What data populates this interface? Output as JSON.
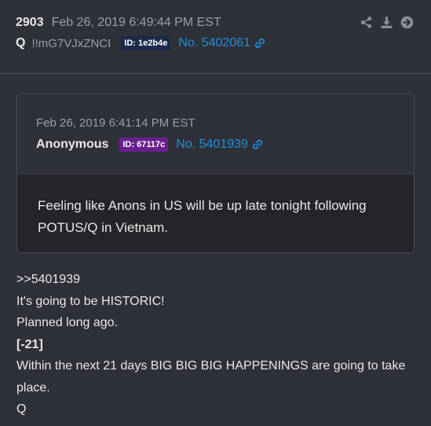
{
  "post": {
    "number": "2903",
    "timestamp": "Feb 26, 2019 6:49:44 PM EST",
    "author": "Q",
    "tripcode": "!!mG7VJxZNCI",
    "id_label": "ID: 1e2b4e",
    "id_color": "#1b2a4a",
    "post_link": "No. 5402061",
    "link_color": "#1e90dd",
    "action_icons": [
      "share-icon",
      "download-icon",
      "arrow-right-circle-icon"
    ]
  },
  "quote": {
    "timestamp": "Feb 26, 2019 6:41:14 PM EST",
    "author": "Anonymous",
    "id_label": "ID: 67117c",
    "id_color": "#6a1f8f",
    "post_link": "No. 5401939",
    "body_line1": "Feeling like Anons in US will be up late tonight following",
    "body_line2": "POTUS/Q in Vietnam."
  },
  "body": {
    "line1": ">>5401939",
    "line2": "It's going to be HISTORIC!",
    "line3": "Planned long ago.",
    "line4": "[-21]",
    "line5": "Within the next 21 days BIG BIG BIG HAPPENINGS are going to take place.",
    "line6": "Q"
  }
}
